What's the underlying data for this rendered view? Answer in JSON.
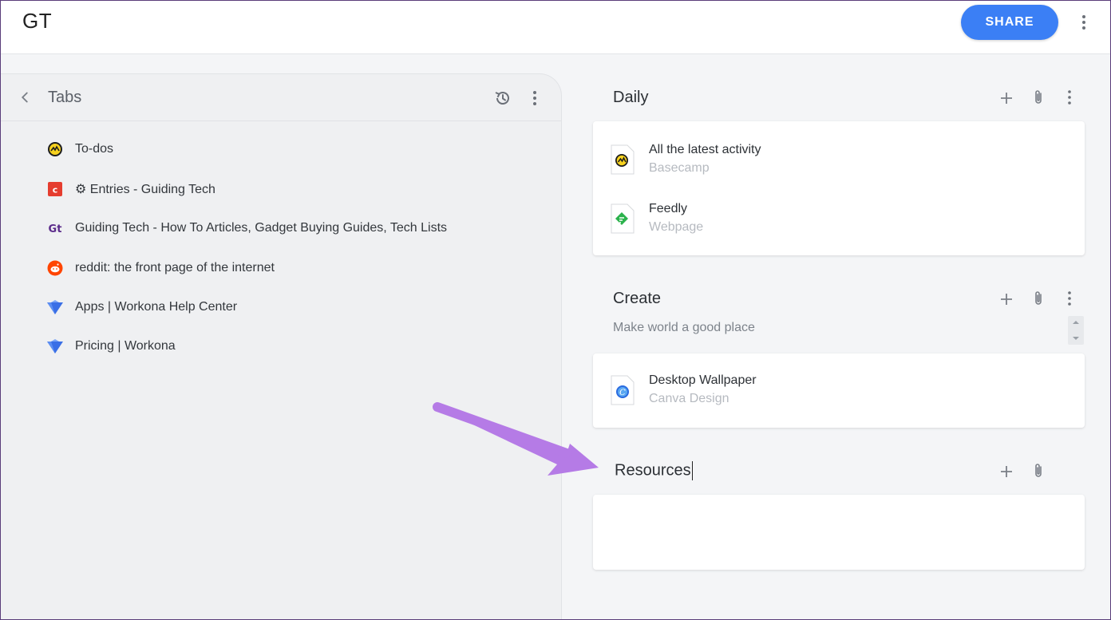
{
  "workspace": {
    "title": "GT",
    "share_label": "SHARE"
  },
  "tabs_panel": {
    "title": "Tabs",
    "items": [
      {
        "label": "To-dos",
        "icon": "basecamp-icon"
      },
      {
        "label": "⚙ Entries - Guiding Tech",
        "icon": "craft-icon"
      },
      {
        "label": "Guiding Tech - How To Articles, Gadget Buying Guides, Tech Lists",
        "icon": "guidingtech-icon"
      },
      {
        "label": "reddit: the front page of the internet",
        "icon": "reddit-icon"
      },
      {
        "label": "Apps | Workona Help Center",
        "icon": "workona-icon"
      },
      {
        "label": "Pricing | Workona",
        "icon": "workona-icon"
      }
    ]
  },
  "sections": {
    "daily": {
      "title": "Daily",
      "items": [
        {
          "name": "All the latest activity",
          "type": "Basecamp",
          "icon": "basecamp-icon"
        },
        {
          "name": "Feedly",
          "type": "Webpage",
          "icon": "feedly-icon"
        }
      ]
    },
    "create": {
      "title": "Create",
      "description": "Make world a good place",
      "items": [
        {
          "name": "Desktop Wallpaper",
          "type": "Canva Design",
          "icon": "canva-icon"
        }
      ]
    },
    "resources": {
      "title": "Resources",
      "items": []
    }
  },
  "colors": {
    "accent": "#3b7ff5",
    "arrow": "#b57be6",
    "panel": "#eff0f2"
  }
}
